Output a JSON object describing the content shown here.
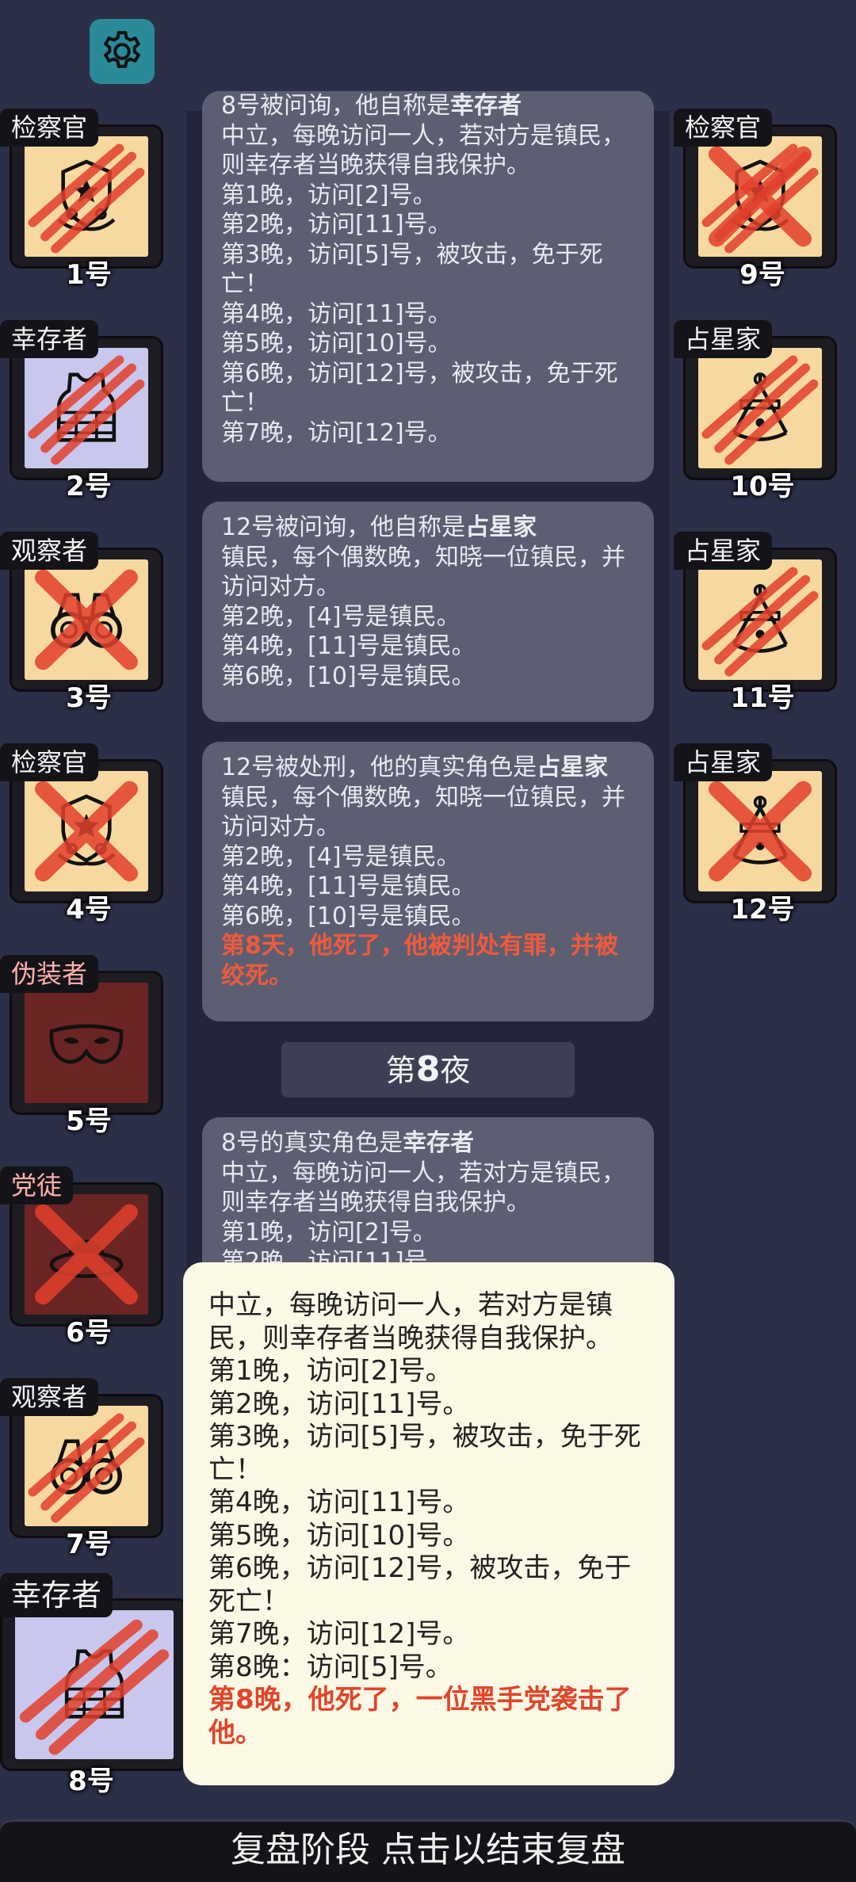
{
  "players_left": [
    {
      "role": "检察官",
      "num": "1号",
      "bg": "#f7d8a0",
      "icon": "scales-badge-icon",
      "mark": "claw-marks",
      "tagColor": "#f4f4f4"
    },
    {
      "role": "幸存者",
      "num": "2号",
      "bg": "#c8c8ee",
      "icon": "vest-icon",
      "mark": "claw-marks",
      "tagColor": "#f4f4f4"
    },
    {
      "role": "观察者",
      "num": "3号",
      "bg": "#f7d8a0",
      "icon": "binoculars-icon",
      "mark": "red-x",
      "tagColor": "#f4f4f4"
    },
    {
      "role": "检察官",
      "num": "4号",
      "bg": "#f7d8a0",
      "icon": "scales-badge-icon",
      "mark": "red-x",
      "tagColor": "#f4f4f4"
    },
    {
      "role": "伪装者",
      "num": "5号",
      "bg": "#6b2424",
      "icon": "mask-icon",
      "mark": "none",
      "tagColor": "#ffb0a8"
    },
    {
      "role": "党徒",
      "num": "6号",
      "bg": "#6b2424",
      "icon": "hat-icon",
      "mark": "red-x",
      "tagColor": "#ffb0a8"
    },
    {
      "role": "观察者",
      "num": "7号",
      "bg": "#f7d8a0",
      "icon": "binoculars-icon",
      "mark": "claw-marks",
      "tagColor": "#f4f4f4"
    }
  ],
  "player_big": {
    "role": "幸存者",
    "num": "8号",
    "bg": "#c8c8ee",
    "icon": "vest-icon",
    "mark": "claw-marks"
  },
  "players_right": [
    {
      "role": "检察官",
      "num": "9号",
      "bg": "#f7d8a0",
      "icon": "scales-badge-icon",
      "mark": "red-x-claw"
    },
    {
      "role": "占星家",
      "num": "10号",
      "bg": "#f7d8a0",
      "icon": "sextant-icon",
      "mark": "claw-marks"
    },
    {
      "role": "占星家",
      "num": "11号",
      "bg": "#f7d8a0",
      "icon": "sextant-icon",
      "mark": "claw-marks"
    },
    {
      "role": "占星家",
      "num": "12号",
      "bg": "#f7d8a0",
      "icon": "sextant-icon",
      "mark": "red-x"
    }
  ],
  "log": {
    "entry1": {
      "header_prefix": "8号被问询，他自称是",
      "header_role": "幸存者",
      "lines": [
        "中立，每晚访问一人，若对方是镇民，则幸存者当晚获得自我保护。",
        "第1晚，访问[2]号。",
        "第2晚，访问[11]号。",
        "第3晚，访问[5]号，被攻击，免于死亡！",
        "第4晚，访问[11]号。",
        "第5晚，访问[10]号。",
        "第6晚，访问[12]号，被攻击，免于死亡！",
        "第7晚，访问[12]号。"
      ]
    },
    "entry2": {
      "header_prefix": "12号被问询，他自称是",
      "header_role": "占星家",
      "lines": [
        "镇民，每个偶数晚，知晓一位镇民，并访问对方。",
        "第2晚，[4]号是镇民。",
        "第4晚，[11]号是镇民。",
        "第6晚，[10]号是镇民。"
      ]
    },
    "entry3": {
      "header_prefix": "12号被处刑，他的真实角色是",
      "header_role": "占星家",
      "lines": [
        "镇民，每个偶数晚，知晓一位镇民，并访问对方。",
        "第2晚，[4]号是镇民。",
        "第4晚，[11]号是镇民。",
        "第6晚，[10]号是镇民。"
      ],
      "death": "第8天，他死了，他被判处有罪，并被绞死。"
    },
    "night": {
      "prefix": "第",
      "num": "8",
      "suffix": "夜"
    },
    "entry4": {
      "header_prefix": "8号的真实角色是",
      "header_role": "幸存者",
      "lines": [
        "中立，每晚访问一人，若对方是镇民，则幸存者当晚获得自我保护。",
        "第1晚，访问[2]号。",
        "第2晚，访问[11]号。"
      ]
    }
  },
  "popup": {
    "lines": [
      "中立，每晚访问一人，若对方是镇民，则幸存者当晚获得自我保护。",
      "第1晚，访问[2]号。",
      "第2晚，访问[11]号。",
      "第3晚，访问[5]号，被攻击，免于死亡！",
      "第4晚，访问[11]号。",
      "第5晚，访问[10]号。",
      "第6晚，访问[12]号，被攻击，免于死亡！",
      "第7晚，访问[12]号。",
      "第8晚：访问[5]号。"
    ],
    "death": "第8晚，他死了，一位黑手党袭击了他。"
  },
  "footer": {
    "label": "复盘阶段 点击以结束复盘"
  },
  "settings": {
    "icon": "gear-icon"
  }
}
